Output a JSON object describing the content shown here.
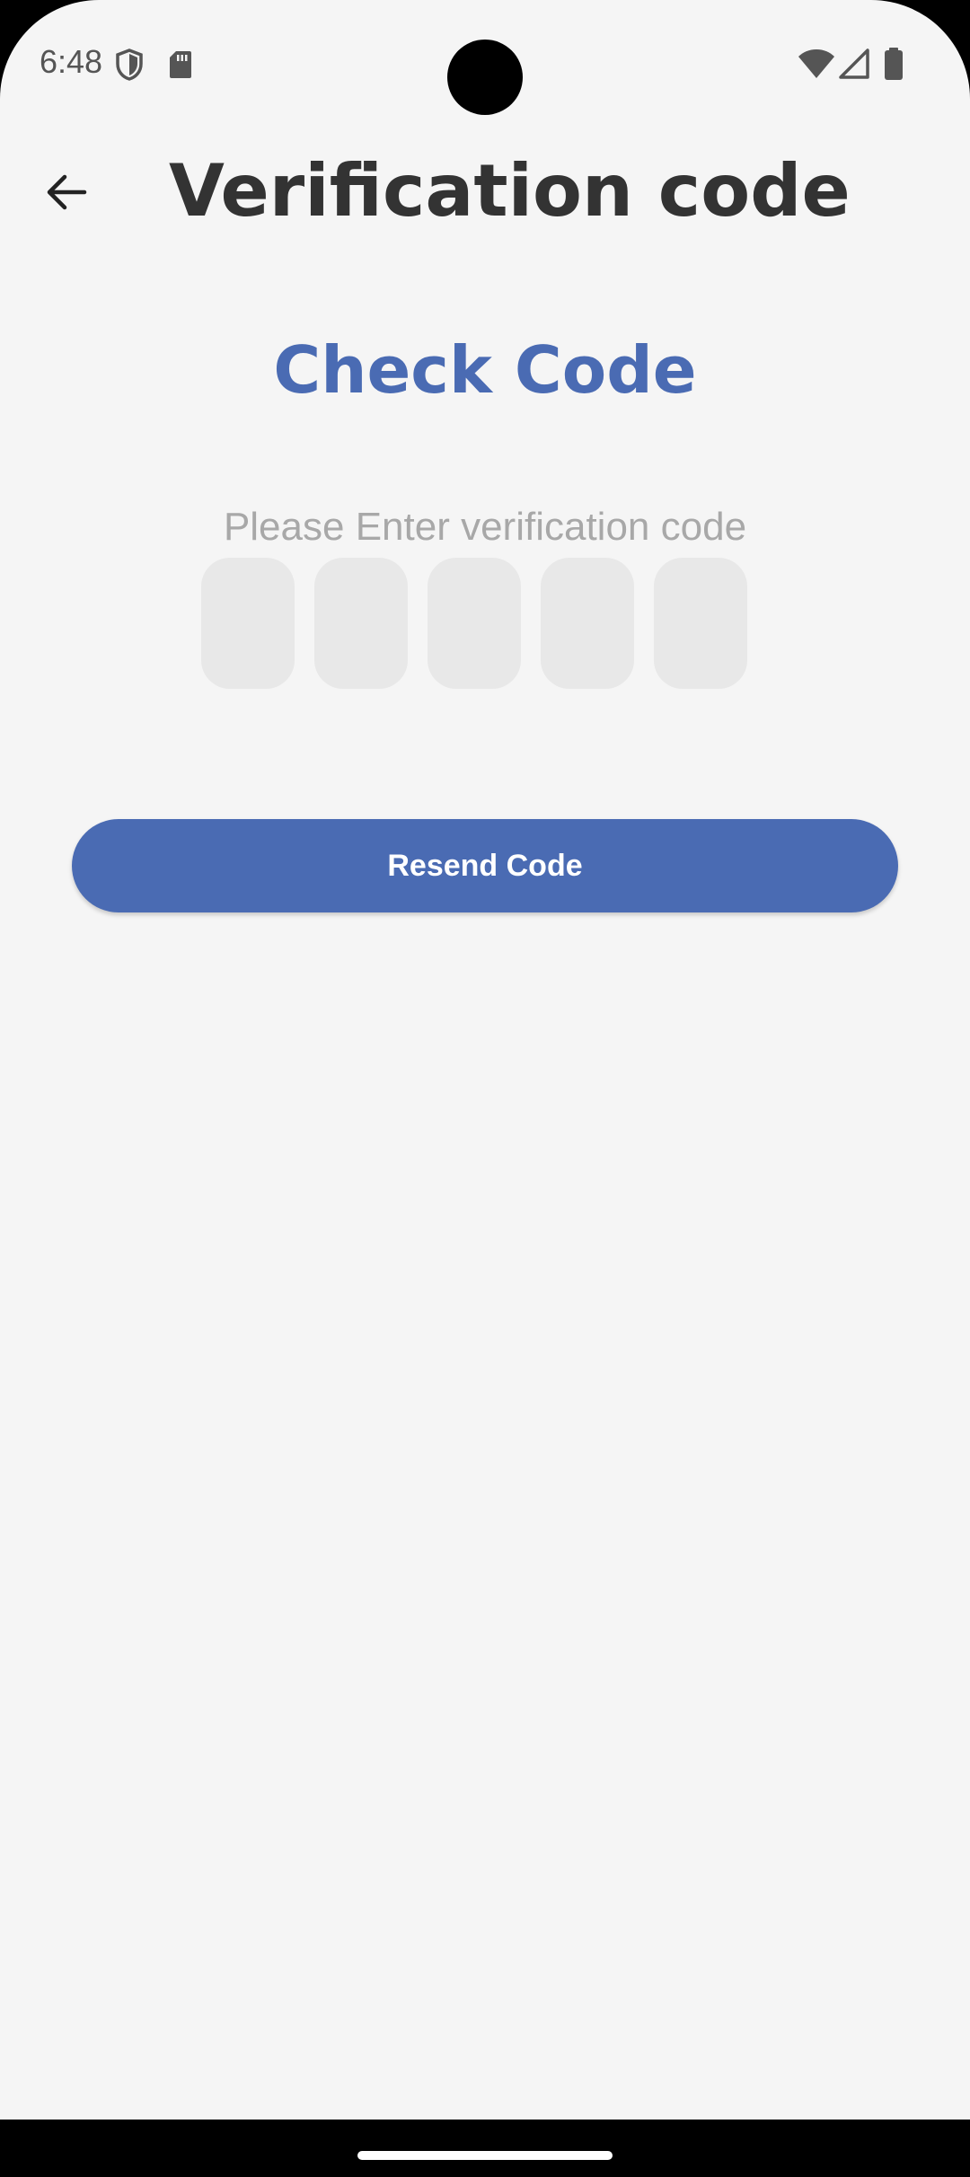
{
  "status_bar": {
    "time": "6:48",
    "icons_left": [
      "shield-icon",
      "sd-card-icon"
    ],
    "icons_right": [
      "wifi-icon",
      "cell-signal-icon",
      "battery-icon"
    ]
  },
  "app_bar": {
    "back_icon": "arrow-left-icon",
    "title": "Verification code"
  },
  "main": {
    "heading": "Check Code",
    "instruction": "Please Enter verification code",
    "otp_boxes": [
      {
        "value": ""
      },
      {
        "value": ""
      },
      {
        "value": ""
      },
      {
        "value": ""
      },
      {
        "value": ""
      }
    ],
    "resend_label": "Resend Code"
  },
  "colors": {
    "accent": "#4a6bb3",
    "background": "#f5f5f5",
    "title_text": "#333333",
    "instruction_text": "#a8a8a8",
    "otp_box": "#e8e8e8",
    "button_text": "#ffffff"
  }
}
